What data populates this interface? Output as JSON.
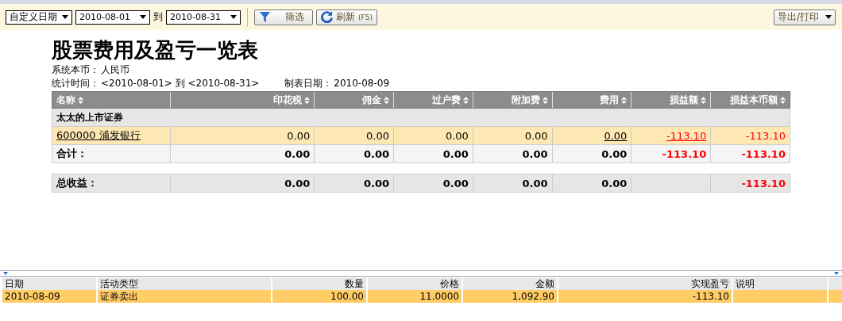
{
  "toolbar": {
    "range_select": "自定义日期",
    "date_from": "2010-08-01",
    "to_label": "到",
    "date_to": "2010-08-31",
    "filter_button": "筛选",
    "refresh_button": "刷新",
    "refresh_shortcut": "(F5)",
    "export_button": "导出/打印"
  },
  "report": {
    "title": "股票费用及盈亏一览表",
    "currency_label": "系统本币：",
    "currency": "人民币",
    "period_label": "统计时间：",
    "period": "<2010-08-01> 到 <2010-08-31>",
    "made_label": "制表日期：",
    "made_date": "2010-08-09",
    "columns": [
      "名称",
      "印花税",
      "佣金",
      "过户费",
      "附加费",
      "费用",
      "损益额",
      "损益本币额"
    ],
    "rows": [
      {
        "kind": "group",
        "label": "太太的上市证券"
      },
      {
        "kind": "item",
        "cells": [
          {
            "text": "600000 浦发银行",
            "link": true,
            "negative": false
          },
          {
            "text": "0.00",
            "link": false,
            "negative": false
          },
          {
            "text": "0.00",
            "link": false,
            "negative": false
          },
          {
            "text": "0.00",
            "link": false,
            "negative": false
          },
          {
            "text": "0.00",
            "link": false,
            "negative": false
          },
          {
            "text": "0.00",
            "link": true,
            "negative": false
          },
          {
            "text": "-113.10",
            "link": true,
            "negative": true
          },
          {
            "text": "-113.10",
            "link": false,
            "negative": true
          }
        ]
      },
      {
        "kind": "total",
        "cells": [
          {
            "text": "合计：",
            "link": false,
            "negative": false
          },
          {
            "text": "0.00",
            "link": false,
            "negative": false
          },
          {
            "text": "0.00",
            "link": false,
            "negative": false
          },
          {
            "text": "0.00",
            "link": false,
            "negative": false
          },
          {
            "text": "0.00",
            "link": false,
            "negative": false
          },
          {
            "text": "0.00",
            "link": false,
            "negative": false
          },
          {
            "text": "-113.10",
            "link": false,
            "negative": true
          },
          {
            "text": "-113.10",
            "link": false,
            "negative": true
          }
        ]
      },
      {
        "kind": "spacer"
      },
      {
        "kind": "grand",
        "cells": [
          {
            "text": "总收益：",
            "link": false,
            "negative": false
          },
          {
            "text": "0.00",
            "link": false,
            "negative": false
          },
          {
            "text": "0.00",
            "link": false,
            "negative": false
          },
          {
            "text": "0.00",
            "link": false,
            "negative": false
          },
          {
            "text": "0.00",
            "link": false,
            "negative": false
          },
          {
            "text": "0.00",
            "link": false,
            "negative": false
          },
          {},
          {
            "text": "-113.10",
            "link": false,
            "negative": true
          }
        ]
      }
    ]
  },
  "detail": {
    "columns": [
      "日期",
      "活动类型",
      "数量",
      "价格",
      "金额",
      "实现盈亏",
      "说明"
    ],
    "rows": [
      {
        "selected": true,
        "cells": [
          "2010-08-09",
          "证券卖出",
          "100.00",
          "11.0000",
          "1,092.90",
          "-113.10",
          ""
        ]
      }
    ]
  }
}
